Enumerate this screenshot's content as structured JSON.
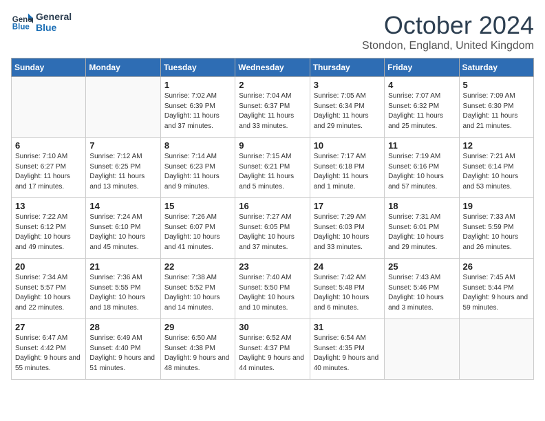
{
  "header": {
    "logo_line1": "General",
    "logo_line2": "Blue",
    "month_title": "October 2024",
    "subtitle": "Stondon, England, United Kingdom"
  },
  "weekdays": [
    "Sunday",
    "Monday",
    "Tuesday",
    "Wednesday",
    "Thursday",
    "Friday",
    "Saturday"
  ],
  "weeks": [
    [
      {
        "day": "",
        "info": ""
      },
      {
        "day": "",
        "info": ""
      },
      {
        "day": "1",
        "info": "Sunrise: 7:02 AM\nSunset: 6:39 PM\nDaylight: 11 hours and 37 minutes."
      },
      {
        "day": "2",
        "info": "Sunrise: 7:04 AM\nSunset: 6:37 PM\nDaylight: 11 hours and 33 minutes."
      },
      {
        "day": "3",
        "info": "Sunrise: 7:05 AM\nSunset: 6:34 PM\nDaylight: 11 hours and 29 minutes."
      },
      {
        "day": "4",
        "info": "Sunrise: 7:07 AM\nSunset: 6:32 PM\nDaylight: 11 hours and 25 minutes."
      },
      {
        "day": "5",
        "info": "Sunrise: 7:09 AM\nSunset: 6:30 PM\nDaylight: 11 hours and 21 minutes."
      }
    ],
    [
      {
        "day": "6",
        "info": "Sunrise: 7:10 AM\nSunset: 6:27 PM\nDaylight: 11 hours and 17 minutes."
      },
      {
        "day": "7",
        "info": "Sunrise: 7:12 AM\nSunset: 6:25 PM\nDaylight: 11 hours and 13 minutes."
      },
      {
        "day": "8",
        "info": "Sunrise: 7:14 AM\nSunset: 6:23 PM\nDaylight: 11 hours and 9 minutes."
      },
      {
        "day": "9",
        "info": "Sunrise: 7:15 AM\nSunset: 6:21 PM\nDaylight: 11 hours and 5 minutes."
      },
      {
        "day": "10",
        "info": "Sunrise: 7:17 AM\nSunset: 6:18 PM\nDaylight: 11 hours and 1 minute."
      },
      {
        "day": "11",
        "info": "Sunrise: 7:19 AM\nSunset: 6:16 PM\nDaylight: 10 hours and 57 minutes."
      },
      {
        "day": "12",
        "info": "Sunrise: 7:21 AM\nSunset: 6:14 PM\nDaylight: 10 hours and 53 minutes."
      }
    ],
    [
      {
        "day": "13",
        "info": "Sunrise: 7:22 AM\nSunset: 6:12 PM\nDaylight: 10 hours and 49 minutes."
      },
      {
        "day": "14",
        "info": "Sunrise: 7:24 AM\nSunset: 6:10 PM\nDaylight: 10 hours and 45 minutes."
      },
      {
        "day": "15",
        "info": "Sunrise: 7:26 AM\nSunset: 6:07 PM\nDaylight: 10 hours and 41 minutes."
      },
      {
        "day": "16",
        "info": "Sunrise: 7:27 AM\nSunset: 6:05 PM\nDaylight: 10 hours and 37 minutes."
      },
      {
        "day": "17",
        "info": "Sunrise: 7:29 AM\nSunset: 6:03 PM\nDaylight: 10 hours and 33 minutes."
      },
      {
        "day": "18",
        "info": "Sunrise: 7:31 AM\nSunset: 6:01 PM\nDaylight: 10 hours and 29 minutes."
      },
      {
        "day": "19",
        "info": "Sunrise: 7:33 AM\nSunset: 5:59 PM\nDaylight: 10 hours and 26 minutes."
      }
    ],
    [
      {
        "day": "20",
        "info": "Sunrise: 7:34 AM\nSunset: 5:57 PM\nDaylight: 10 hours and 22 minutes."
      },
      {
        "day": "21",
        "info": "Sunrise: 7:36 AM\nSunset: 5:55 PM\nDaylight: 10 hours and 18 minutes."
      },
      {
        "day": "22",
        "info": "Sunrise: 7:38 AM\nSunset: 5:52 PM\nDaylight: 10 hours and 14 minutes."
      },
      {
        "day": "23",
        "info": "Sunrise: 7:40 AM\nSunset: 5:50 PM\nDaylight: 10 hours and 10 minutes."
      },
      {
        "day": "24",
        "info": "Sunrise: 7:42 AM\nSunset: 5:48 PM\nDaylight: 10 hours and 6 minutes."
      },
      {
        "day": "25",
        "info": "Sunrise: 7:43 AM\nSunset: 5:46 PM\nDaylight: 10 hours and 3 minutes."
      },
      {
        "day": "26",
        "info": "Sunrise: 7:45 AM\nSunset: 5:44 PM\nDaylight: 9 hours and 59 minutes."
      }
    ],
    [
      {
        "day": "27",
        "info": "Sunrise: 6:47 AM\nSunset: 4:42 PM\nDaylight: 9 hours and 55 minutes."
      },
      {
        "day": "28",
        "info": "Sunrise: 6:49 AM\nSunset: 4:40 PM\nDaylight: 9 hours and 51 minutes."
      },
      {
        "day": "29",
        "info": "Sunrise: 6:50 AM\nSunset: 4:38 PM\nDaylight: 9 hours and 48 minutes."
      },
      {
        "day": "30",
        "info": "Sunrise: 6:52 AM\nSunset: 4:37 PM\nDaylight: 9 hours and 44 minutes."
      },
      {
        "day": "31",
        "info": "Sunrise: 6:54 AM\nSunset: 4:35 PM\nDaylight: 9 hours and 40 minutes."
      },
      {
        "day": "",
        "info": ""
      },
      {
        "day": "",
        "info": ""
      }
    ]
  ]
}
